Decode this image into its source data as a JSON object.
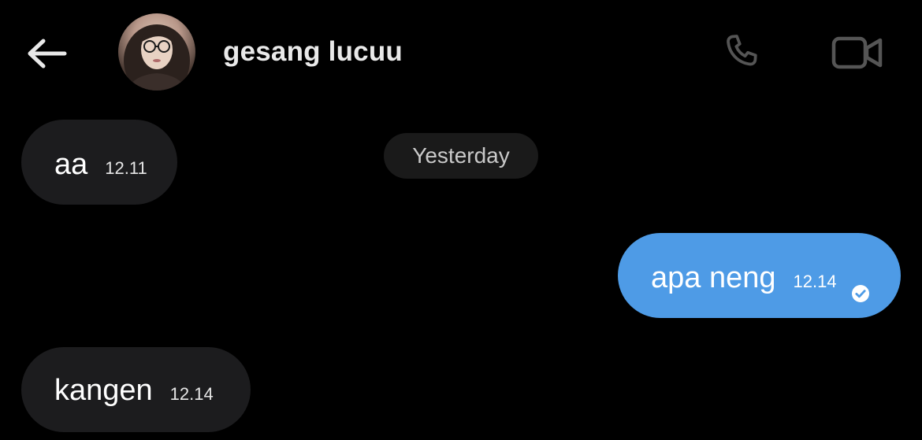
{
  "header": {
    "contact_name": "gesang lucuu",
    "back_icon": "arrow-left-icon",
    "call_icon": "phone-icon",
    "video_icon": "video-camera-icon"
  },
  "date_separator": "Yesterday",
  "messages": [
    {
      "direction": "incoming",
      "text": "aa",
      "time": "12.11"
    },
    {
      "direction": "outgoing",
      "text": "apa neng",
      "time": "12.14",
      "status_icon": "read-check-icon"
    },
    {
      "direction": "incoming",
      "text": "kangen",
      "time": "12.14"
    }
  ],
  "colors": {
    "background": "#000000",
    "incoming_bubble": "#1c1c1e",
    "outgoing_bubble": "#4e9be6",
    "date_pill": "#1a1a1a",
    "icon_gray": "#555555"
  }
}
